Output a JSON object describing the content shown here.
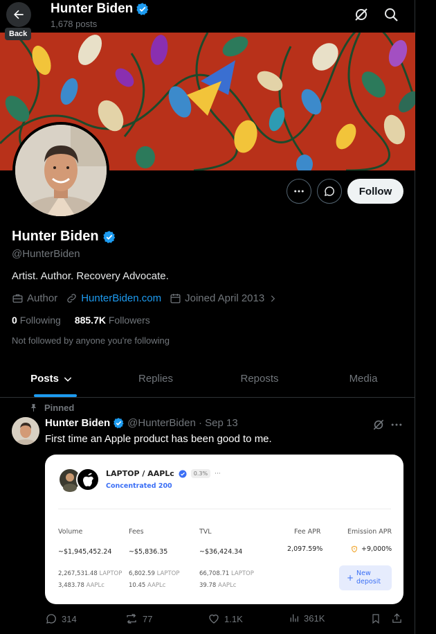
{
  "header": {
    "name": "Hunter Biden",
    "posts_count": "1,678 posts",
    "back_tooltip": "Back"
  },
  "profile": {
    "name": "Hunter Biden",
    "handle": "@HunterBiden",
    "bio": "Artist. Author. Recovery Advocate.",
    "occupation": "Author",
    "website": "HunterBiden.com",
    "joined": "Joined April 2013",
    "following_count": "0",
    "following_label": "Following",
    "followers_count": "885.7K",
    "followers_label": "Followers",
    "not_followed": "Not followed by anyone you're following",
    "follow_label": "Follow"
  },
  "tabs": [
    {
      "label": "Posts"
    },
    {
      "label": "Replies"
    },
    {
      "label": "Reposts"
    },
    {
      "label": "Media"
    }
  ],
  "post": {
    "pinned_label": "Pinned",
    "name": "Hunter Biden",
    "meta": "@HunterBiden · Sep 13",
    "text": "First time an Apple product has been good to me.",
    "card": {
      "title": "LAPTOP / AAPLc",
      "pct": "0.3%",
      "more": "···",
      "subtitle": "Concentrated 200",
      "labels": {
        "volume": "Volume",
        "fees": "Fees",
        "tvl": "TVL",
        "fee_apr": "Fee APR",
        "emission_apr": "Emission APR"
      },
      "values": {
        "volume": "~$1,945,452.24",
        "fees": "~$5,836.35",
        "tvl": "~$36,424.34",
        "fee_apr": "2,097.59%",
        "emission_apr": "+9,000%"
      },
      "volume_laptop": "2,267,531.48",
      "volume_aaplc": "3,483.78",
      "fees_laptop": "6,802.59",
      "fees_aaplc": "10.45",
      "tvl_laptop": "66,708.71",
      "tvl_aaplc": "39.78",
      "token_laptop": "LAPTOP",
      "token_aaplc": "AAPLc",
      "button": "New deposit"
    },
    "actions": {
      "replies": "314",
      "reposts": "77",
      "likes": "1.1K",
      "views": "361K"
    }
  },
  "colors": {
    "accent": "#1d9bf0",
    "muted": "#71767b",
    "verified": "#1d9bf0",
    "card_accent": "#3b6ff5"
  }
}
